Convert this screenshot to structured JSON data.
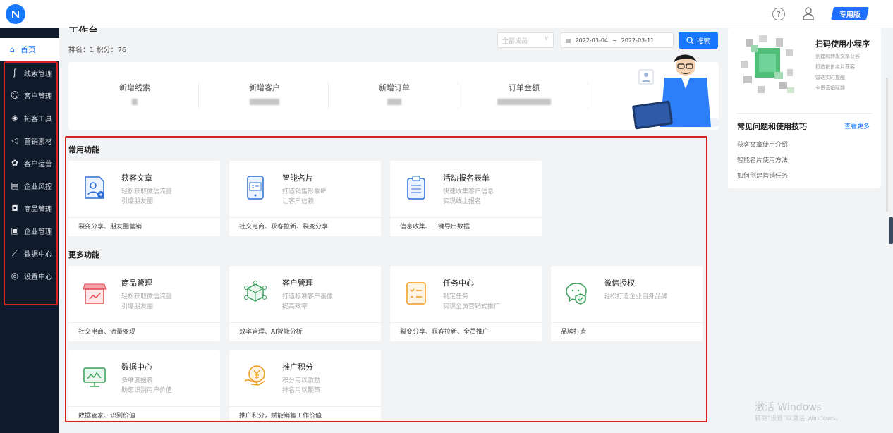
{
  "header": {
    "help_icon": "?",
    "badge": "专用版"
  },
  "sidebar": {
    "home": "首页",
    "items": [
      {
        "label": "线索管理",
        "icon": "ʃ"
      },
      {
        "label": "客户管理",
        "icon": "☺"
      },
      {
        "label": "拓客工具",
        "icon": "◈"
      },
      {
        "label": "营销素材",
        "icon": "◁"
      },
      {
        "label": "客户运营",
        "icon": "✿"
      },
      {
        "label": "企业风控",
        "icon": "▤"
      },
      {
        "label": "商品管理",
        "icon": "◘"
      },
      {
        "label": "企业管理",
        "icon": "▣"
      },
      {
        "label": "数据中心",
        "icon": "⟋"
      },
      {
        "label": "设置中心",
        "icon": "◎"
      }
    ]
  },
  "main": {
    "title": "工作台",
    "rank": "排名：1  积分：76",
    "filter_placeholder": "全部成员",
    "date_start": "2022-03-04",
    "date_sep": "~",
    "date_end": "2022-03-11",
    "search_label": "搜索",
    "stats": [
      "新增线索",
      "新增客户",
      "新增订单",
      "订单金额"
    ],
    "common_title": "常用功能",
    "more_title": "更多功能",
    "common_cards": [
      {
        "title": "获客文章",
        "s1": "轻松获取微信流量",
        "s2": "引爆朋友圈",
        "foot": "裂变分享、朋友圈营销"
      },
      {
        "title": "智能名片",
        "s1": "打造销售形象IP",
        "s2": "让客户信赖",
        "foot": "社交电商、获客拉新、裂变分享"
      },
      {
        "title": "活动报名表单",
        "s1": "快速收集客户信息",
        "s2": "实现线上报名",
        "foot": "信息收集、一键导出数据"
      }
    ],
    "more_cards": [
      {
        "title": "商品管理",
        "s1": "轻松获取微信流量",
        "s2": "引爆朋友圈",
        "foot": "社交电商、流量变现"
      },
      {
        "title": "客户管理",
        "s1": "打造标准客户画像",
        "s2": "提高效率",
        "foot": "效率管理、AI智能分析"
      },
      {
        "title": "任务中心",
        "s1": "制定任务",
        "s2": "实现全员营销式推广",
        "foot": "裂变分享、获客拉新、全员推广"
      },
      {
        "title": "微信授权",
        "s1": "轻松打造企业自身品牌",
        "s2": "",
        "foot": "品牌打造"
      },
      {
        "title": "数据中心",
        "s1": "多维度报表",
        "s2": "助您识别用户价值",
        "foot": "数据管家、识别价值"
      },
      {
        "title": "推广积分",
        "s1": "积分用以激励",
        "s2": "排名用以鞭策",
        "foot": "推广积分，赋能销售工作价值"
      }
    ]
  },
  "right": {
    "mini_title": "扫码使用小程序",
    "mini_lines": [
      "创建和转发文章获客",
      "打造销售名片获客",
      "雷达实时提醒",
      "全员营销赋能"
    ],
    "faq_title": "常见问题和使用技巧",
    "faq_more": "查看更多",
    "faq_items": [
      "获客文章使用介绍",
      "智能名片使用方法",
      "如何创建营销任务"
    ]
  },
  "watermark": {
    "line1": "激活 Windows",
    "line2": "转到\"设置\"以激活 Windows。"
  },
  "colors": {
    "accent": "#1677ff",
    "sidebar": "#0f1a2b",
    "highlight": "#d9231f"
  }
}
